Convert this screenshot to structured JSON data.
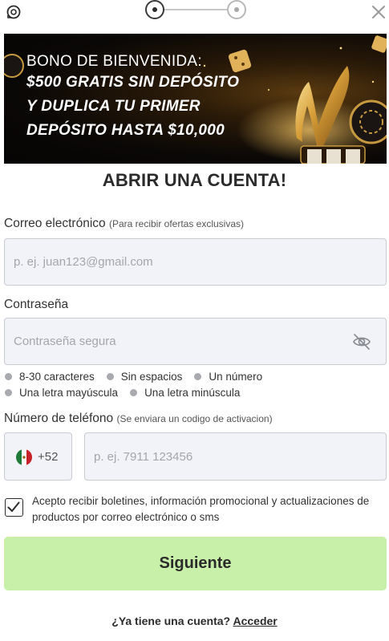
{
  "topbar": {
    "support_icon": "headset-icon",
    "close_icon": "close-icon",
    "steps": {
      "current": 1,
      "total": 2
    }
  },
  "banner": {
    "line1": "BONO DE BIENVENIDA:",
    "line2": "$500 GRATIS SIN DEPÓSITO",
    "line3": "Y DUPLICA TU PRIMER",
    "line4": "DEPÓSITO HASTA $10,000"
  },
  "title": "ABRIR UNA CUENTA!",
  "email": {
    "label": "Correo electrónico",
    "hint": "(Para recibir ofertas exclusivas)",
    "placeholder": "p. ej. juan123@gmail.com",
    "value": ""
  },
  "password": {
    "label": "Contraseña",
    "placeholder": "Contraseña segura",
    "value": "",
    "toggle_icon": "eye-off-icon",
    "requirements": [
      "8-30 caracteres",
      "Sin espacios",
      "Un número",
      "Una letra mayúscula",
      "Una letra minúscula"
    ]
  },
  "phone": {
    "label": "Número de teléfono",
    "hint": "(Se enviara un codigo de activacion)",
    "country_flag": "mexico-flag-icon",
    "country_code": "+52",
    "placeholder": "p. ej. 7911 123456",
    "value": ""
  },
  "consent": {
    "checked": true,
    "text": "Acepto recibir boletines, información promocional y actualizaciones de productos por correo electrónico o sms"
  },
  "submit_label": "Siguiente",
  "login": {
    "prompt": "¿Ya tiene una cuenta?",
    "link": "Acceder"
  },
  "colors": {
    "button_bg": "#c8f0a8",
    "input_bg": "#f2f3f8",
    "input_border": "#c9ccd4",
    "text": "#2b2b2b"
  }
}
